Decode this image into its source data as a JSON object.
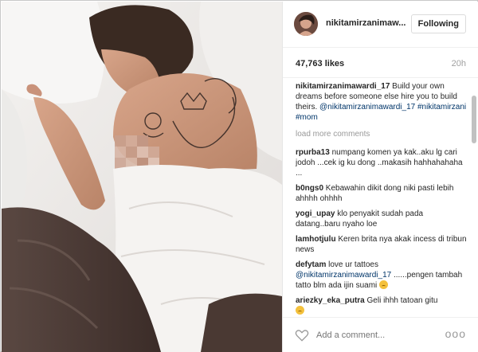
{
  "post": {
    "username": "nikitamirzanimaw...",
    "follow_label": "Following",
    "likes": "47,763 likes",
    "time_ago": "20h"
  },
  "caption": {
    "user": "nikitamirzanimawardi_17",
    "text_a": "Build your own dreams before someone else hire you to build theirs.",
    "tag": "@nikitamirzanimawardi_17",
    "hashtags": "#nikitamirzani #mom"
  },
  "load_more": "load more comments",
  "comments": [
    {
      "user": "rpurba13",
      "text": "numpang komen ya kak..aku lg cari jodoh ...cek ig ku dong ..makasih hahhahahaha ..."
    },
    {
      "user": "b0ngs0",
      "text": "Kebawahin dikit dong niki pasti lebih ahhhh ohhhh"
    },
    {
      "user": "yogi_upay",
      "text": "klo penyakit sudah pada datang..baru nyaho loe"
    },
    {
      "user": "lamhotjulu",
      "text": "Keren brita nya akak incess di tribun news"
    },
    {
      "user": "defytam",
      "text": "love ur tattoes",
      "tag": "@nikitamirzanimawardi_17",
      "text_b": "......pengen tambah tatto blm ada ijin suami"
    },
    {
      "user": "ariezky_eka_putra",
      "text": "Geli ihhh tatoan gitu"
    }
  ],
  "footer": {
    "placeholder": "Add a comment...",
    "more": "ooo"
  },
  "icons": {
    "heart": "heart-outline-icon",
    "emoji": "emoji-icon",
    "more": "more-options-icon"
  },
  "colors": {
    "link": "#003569",
    "border": "#dbdbdb",
    "muted": "#999999"
  }
}
